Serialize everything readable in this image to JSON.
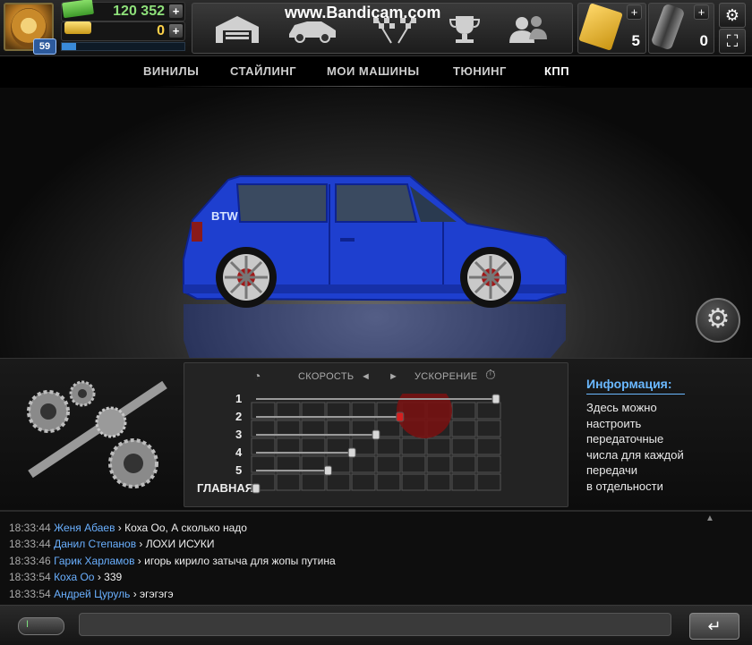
{
  "header": {
    "level": "59",
    "cash": "120 352",
    "gold": "0",
    "xp_progress": 0.12,
    "plus": "+",
    "watermark": "www.Bandicam.com",
    "tickets": "5",
    "nitro": "0",
    "nav_icons": [
      "garage-icon",
      "car-icon",
      "race-flags-icon",
      "trophy-icon",
      "friends-icon"
    ]
  },
  "tabs": [
    "ВИНИЛЫ",
    "СТАЙЛИНГ",
    "МОИ МАШИНЫ",
    "ТЮНИНГ",
    "КПП"
  ],
  "active_tab": "КПП",
  "car": {
    "badge": "BTW",
    "color": "#1e3fcf"
  },
  "gearbox": {
    "speed_label": "СКОРОСТЬ",
    "accel_label": "УСКОРЕНИЕ",
    "arrow_left": "◄",
    "arrow_right": "►",
    "gears": [
      "1",
      "2",
      "3",
      "4",
      "5",
      "ГЛАВНАЯ"
    ],
    "gear_positions": [
      1.0,
      0.6,
      0.5,
      0.4,
      0.3,
      0.0
    ]
  },
  "info": {
    "title": "Информация:",
    "lines": [
      "Здесь можно",
      "настроить",
      "передаточные",
      "числа для каждой",
      "передачи",
      "в отдельности"
    ]
  },
  "chat": {
    "messages": [
      {
        "time": "18:33:44",
        "user": "Женя Абаев",
        "text": "Коха Оо, А сколько надо"
      },
      {
        "time": "18:33:44",
        "user": "Данил Степанов",
        "text": "ЛОХИ ИСУКИ"
      },
      {
        "time": "18:33:46",
        "user": "Гарик Харламов",
        "text": "игорь кирило затыча для жопы путина"
      },
      {
        "time": "18:33:54",
        "user": "Коха Оо",
        "text": "339"
      },
      {
        "time": "18:33:54",
        "user": "Андрей Цуруль",
        "text": "эгэгэгэ"
      }
    ],
    "send_symbol": "↵",
    "toggle_label": "I",
    "input_value": ""
  }
}
